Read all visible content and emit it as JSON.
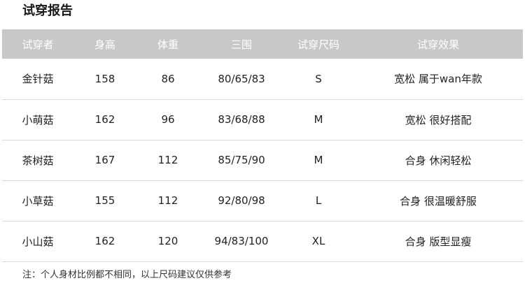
{
  "title": "试穿报告",
  "table": {
    "headers": [
      "试穿者",
      "身高",
      "体重",
      "三围",
      "试穿尺码",
      "试穿效果"
    ],
    "rows": [
      [
        "金针菇",
        "158",
        "86",
        "80/65/83",
        "S",
        "宽松 属于wan年款"
      ],
      [
        "小萌菇",
        "162",
        "96",
        "83/68/88",
        "M",
        "宽松 很好搭配"
      ],
      [
        "茶树菇",
        "167",
        "112",
        "85/75/90",
        "M",
        "合身 休闲轻松"
      ],
      [
        "小草菇",
        "155",
        "112",
        "92/80/98",
        "L",
        "合身 很温暖舒服"
      ],
      [
        "小山菇",
        "162",
        "120",
        "94/83/100",
        "XL",
        "合身 版型显瘦"
      ]
    ]
  },
  "note": "注：个人身材比例都不相同，以上尺码建议仅供参考",
  "colors": {
    "header_bg": "#c8c8c8",
    "header_text": "#ffffff",
    "divider": "#d9d9d9"
  }
}
